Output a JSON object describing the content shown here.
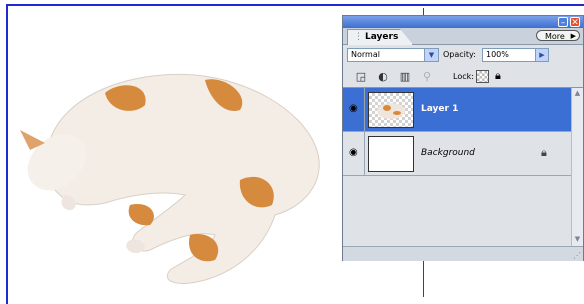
{
  "palette": {
    "tab_label": "Layers",
    "more_label": "More",
    "blend_mode": "Normal",
    "opacity_label": "Opacity:",
    "opacity_value": "100%",
    "lock_label": "Lock:",
    "layers": [
      {
        "name": "Layer 1",
        "selected": true
      },
      {
        "name": "Background",
        "selected": false
      }
    ]
  },
  "colors": {
    "selection": "#3c6fd4",
    "frame": "#1f2bd0",
    "titlebar": "#3e6fcf"
  },
  "icons": [
    "minimize-icon",
    "close-icon",
    "new-fill-layer-icon",
    "adjustment-layer-icon",
    "trash-icon",
    "link-icon",
    "lock-transparent-icon",
    "lock-icon",
    "eye-icon",
    "chevron-down-icon"
  ]
}
